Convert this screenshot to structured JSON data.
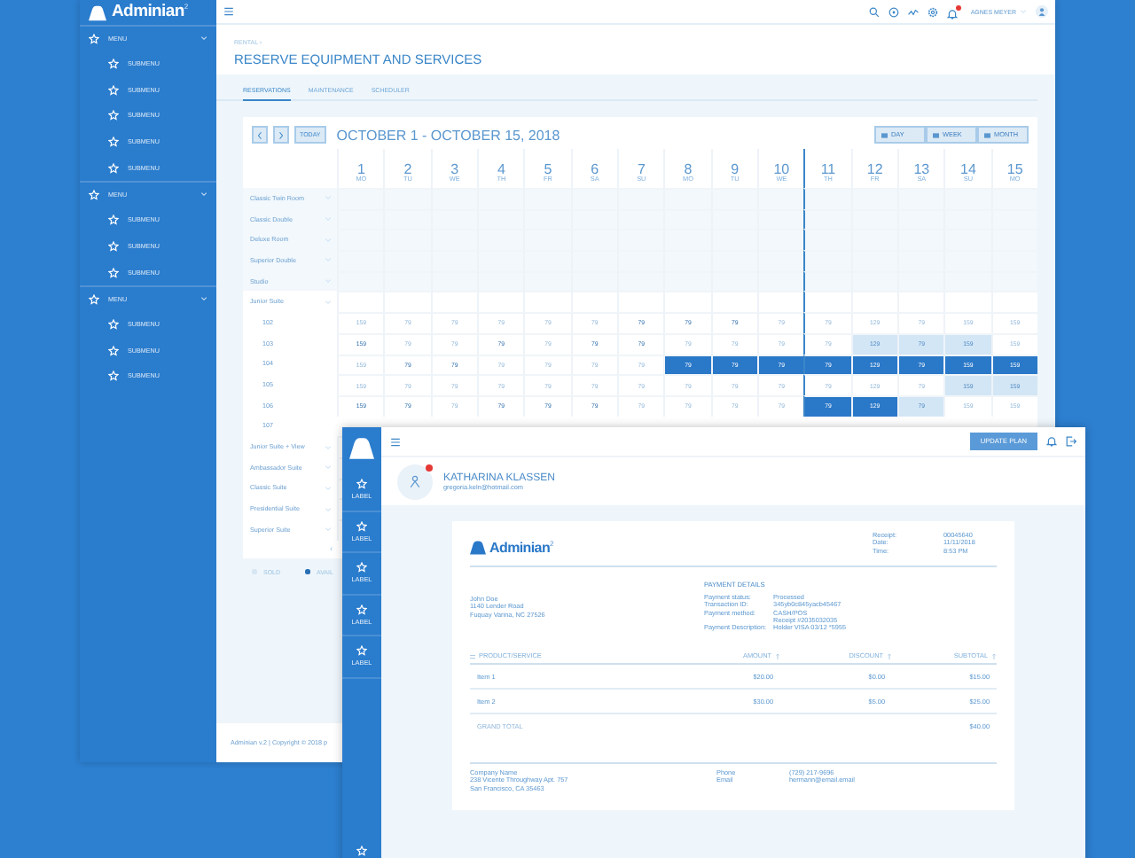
{
  "admin_window": {
    "logo": {
      "name": "Adminian",
      "sup": "2"
    },
    "sidebar": [
      {
        "label": "MENU",
        "children": [
          {
            "label": "SUBMENU"
          },
          {
            "label": "SUBMENU"
          },
          {
            "label": "SUBMENU"
          },
          {
            "label": "SUBMENU"
          },
          {
            "label": "SUBMENU"
          }
        ]
      },
      {
        "label": "MENU",
        "children": [
          {
            "label": "SUBMENU"
          },
          {
            "label": "SUBMENU"
          },
          {
            "label": "SUBMENU"
          }
        ]
      },
      {
        "label": "MENU",
        "children": [
          {
            "label": "SUBMENU"
          },
          {
            "label": "SUBMENU"
          },
          {
            "label": "SUBMENU"
          }
        ]
      }
    ],
    "topbar": {
      "user": "AGNES MEYER",
      "notification": true
    },
    "breadcrumb": "RENTAL ›",
    "title": "RESERVE EQUIPMENT AND SERVICES",
    "tabs": [
      {
        "label": "RESERVATIONS",
        "selected": true
      },
      {
        "label": "MAINTENANCE",
        "selected": false
      },
      {
        "label": "SCHEDULER",
        "selected": false
      }
    ],
    "calendar": {
      "today_button": "TODAY",
      "range": "OCTOBER 1 - OCTOBER 15, 2018",
      "views": [
        "DAY",
        "WEEK",
        "MONTH"
      ],
      "days": [
        {
          "day": "1",
          "weekday": "MO",
          "today": false
        },
        {
          "day": "2",
          "weekday": "TU",
          "today": false
        },
        {
          "day": "3",
          "weekday": "WE",
          "today": false
        },
        {
          "day": "4",
          "weekday": "TH",
          "today": false
        },
        {
          "day": "5",
          "weekday": "FR",
          "today": false
        },
        {
          "day": "6",
          "weekday": "SA",
          "today": false
        },
        {
          "day": "7",
          "weekday": "SU",
          "today": false
        },
        {
          "day": "8",
          "weekday": "MO",
          "today": false
        },
        {
          "day": "9",
          "weekday": "TU",
          "today": false
        },
        {
          "day": "10",
          "weekday": "WE",
          "today": false
        },
        {
          "day": "11",
          "weekday": "TH",
          "today": true
        },
        {
          "day": "12",
          "weekday": "FR",
          "today": false
        },
        {
          "day": "13",
          "weekday": "SA",
          "today": false
        },
        {
          "day": "14",
          "weekday": "SU",
          "today": false
        },
        {
          "day": "15",
          "weekday": "MO",
          "today": false
        }
      ],
      "rooms": [
        {
          "label": "Classic Twin Room"
        },
        {
          "label": "Classic Double"
        },
        {
          "label": "Deluxe Room"
        },
        {
          "label": "Superior Double"
        },
        {
          "label": "Studio"
        },
        {
          "label": "Junior Suite",
          "children": [
            {
              "label": "102",
              "cells": [
                {
                  "text": "159",
                  "kind": "faint"
                },
                {
                  "text": "79",
                  "kind": "faint"
                },
                {
                  "text": "79",
                  "kind": "faint"
                },
                {
                  "text": "79",
                  "kind": "faint"
                },
                {
                  "text": "79",
                  "kind": "faint"
                },
                {
                  "text": "79",
                  "kind": "faint"
                },
                {
                  "text": "79",
                  "kind": "normal"
                },
                {
                  "text": "79",
                  "kind": "normal"
                },
                {
                  "text": "79",
                  "kind": "normal"
                },
                {
                  "text": "79",
                  "kind": "faint"
                },
                {
                  "text": "79",
                  "kind": "faint"
                },
                {
                  "text": "129",
                  "kind": "faint"
                },
                {
                  "text": "79",
                  "kind": "faint"
                },
                {
                  "text": "159",
                  "kind": "faint"
                },
                {
                  "text": "159",
                  "kind": "faint"
                }
              ]
            },
            {
              "label": "103",
              "cells": [
                {
                  "text": "159",
                  "kind": "normal"
                },
                {
                  "text": "79",
                  "kind": "faint"
                },
                {
                  "text": "79",
                  "kind": "faint"
                },
                {
                  "text": "79",
                  "kind": "normal"
                },
                {
                  "text": "79",
                  "kind": "faint"
                },
                {
                  "text": "79",
                  "kind": "normal"
                },
                {
                  "text": "79",
                  "kind": "normal"
                },
                {
                  "text": "79",
                  "kind": "faint"
                },
                {
                  "text": "79",
                  "kind": "faint"
                },
                {
                  "text": "79",
                  "kind": "faint"
                },
                {
                  "text": "79",
                  "kind": "faint"
                },
                {
                  "text": "129",
                  "kind": "pending"
                },
                {
                  "text": "79",
                  "kind": "pending"
                },
                {
                  "text": "159",
                  "kind": "pending"
                },
                {
                  "text": "159",
                  "kind": "faint"
                }
              ]
            },
            {
              "label": "104",
              "cells": [
                {
                  "text": "159",
                  "kind": "faint"
                },
                {
                  "text": "79",
                  "kind": "normal"
                },
                {
                  "text": "79",
                  "kind": "normal"
                },
                {
                  "text": "79",
                  "kind": "faint"
                },
                {
                  "text": "79",
                  "kind": "faint"
                },
                {
                  "text": "79",
                  "kind": "faint"
                },
                {
                  "text": "79",
                  "kind": "faint"
                },
                {
                  "text": "79",
                  "kind": "booked"
                },
                {
                  "text": "79",
                  "kind": "booked"
                },
                {
                  "text": "79",
                  "kind": "booked"
                },
                {
                  "text": "79",
                  "kind": "booked"
                },
                {
                  "text": "129",
                  "kind": "booked"
                },
                {
                  "text": "79",
                  "kind": "booked"
                },
                {
                  "text": "159",
                  "kind": "booked"
                },
                {
                  "text": "159",
                  "kind": "booked"
                }
              ]
            },
            {
              "label": "105",
              "cells": [
                {
                  "text": "159",
                  "kind": "faint"
                },
                {
                  "text": "79",
                  "kind": "faint"
                },
                {
                  "text": "79",
                  "kind": "faint"
                },
                {
                  "text": "79",
                  "kind": "faint"
                },
                {
                  "text": "79",
                  "kind": "faint"
                },
                {
                  "text": "79",
                  "kind": "faint"
                },
                {
                  "text": "79",
                  "kind": "faint"
                },
                {
                  "text": "79",
                  "kind": "faint"
                },
                {
                  "text": "79",
                  "kind": "faint"
                },
                {
                  "text": "79",
                  "kind": "faint"
                },
                {
                  "text": "79",
                  "kind": "faint"
                },
                {
                  "text": "129",
                  "kind": "faint"
                },
                {
                  "text": "79",
                  "kind": "faint"
                },
                {
                  "text": "159",
                  "kind": "pending"
                },
                {
                  "text": "159",
                  "kind": "pending"
                }
              ]
            },
            {
              "label": "106",
              "cells": [
                {
                  "text": "159",
                  "kind": "normal"
                },
                {
                  "text": "79",
                  "kind": "normal"
                },
                {
                  "text": "79",
                  "kind": "faint"
                },
                {
                  "text": "79",
                  "kind": "normal"
                },
                {
                  "text": "79",
                  "kind": "normal"
                },
                {
                  "text": "79",
                  "kind": "normal"
                },
                {
                  "text": "79",
                  "kind": "faint"
                },
                {
                  "text": "79",
                  "kind": "faint"
                },
                {
                  "text": "79",
                  "kind": "faint"
                },
                {
                  "text": "79",
                  "kind": "faint"
                },
                {
                  "text": "79",
                  "kind": "booked"
                },
                {
                  "text": "129",
                  "kind": "booked"
                },
                {
                  "text": "79",
                  "kind": "pending"
                },
                {
                  "text": "159",
                  "kind": "faint"
                },
                {
                  "text": "159",
                  "kind": "faint"
                }
              ]
            },
            {
              "label": "107"
            }
          ]
        },
        {
          "label": "Junior Suite + View"
        },
        {
          "label": "Ambassador Suite"
        },
        {
          "label": "Classic Suite"
        },
        {
          "label": "Presidential Suite"
        },
        {
          "label": "Superior Suite"
        }
      ]
    },
    "scroll_left": "‹",
    "legend": [
      {
        "label": "SOLD",
        "color": "#d6e6f3"
      },
      {
        "label": "AVAIL",
        "color": "#2a6fb5"
      }
    ],
    "footer": "Adminian v.2 | Copyright © 2018 p"
  },
  "receipt_window": {
    "sidebar": [
      {
        "label": "LABEL"
      },
      {
        "label": "LABEL"
      },
      {
        "label": "LABEL"
      },
      {
        "label": "LABEL"
      },
      {
        "label": "LABEL"
      }
    ],
    "update_button": "UPDATE PLAN",
    "profile": {
      "name": "KATHARINA KLASSEN",
      "email": "gregoria.keln@hotmail.com",
      "notification": true
    },
    "receipt": {
      "logo": {
        "name": "Adminian",
        "sup": "2"
      },
      "meta": [
        {
          "label": "Receipt:",
          "value": "00045640"
        },
        {
          "label": "Date:",
          "value": "11/11/2018"
        },
        {
          "label": "Time:",
          "value": "8:53 PM"
        }
      ],
      "address": [
        "John Doe",
        "1140 Lender Road",
        "Fuquay Varina, NC 27526"
      ],
      "payment_title": "PAYMENT DETAILS",
      "payment": [
        {
          "label": "Payment status:",
          "value": "Processed"
        },
        {
          "label": "Transaction ID:",
          "value": "345yb0c845yacb45467"
        },
        {
          "label": "Payment method:",
          "value": "CASH/POS"
        },
        {
          "value": "Receipt #2035032035"
        },
        {
          "label": "Payment Description:",
          "value": "Holder VISA 03/12 *5955"
        }
      ],
      "columns": [
        "PRODUCT/SERVICE",
        "AMOUNT",
        "DISCOUNT",
        "SUBTOTAL"
      ],
      "items": [
        [
          "Item 1",
          "$20.00",
          "$0.00",
          "$15.00"
        ],
        [
          "Item 2",
          "$30.00",
          "$5.00",
          "$25.00"
        ]
      ],
      "total": {
        "label": "GRAND TOTAL",
        "value": "$40.00"
      },
      "company": [
        "Company Name",
        "238 Vicente Throughway Apt. 757",
        "San Francisco, CA 35463"
      ],
      "contacts": [
        {
          "label": "Phone",
          "value": "(729) 217-9696"
        },
        {
          "label": "Email",
          "value": "hermann@email.email"
        }
      ]
    }
  }
}
